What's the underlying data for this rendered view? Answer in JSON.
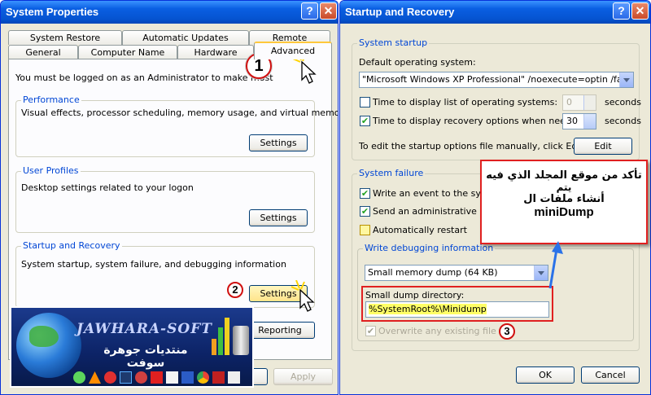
{
  "sys": {
    "title": "System Properties",
    "tabs_back": [
      "System Restore",
      "Automatic Updates",
      "Remote"
    ],
    "tabs_front": [
      "General",
      "Computer Name",
      "Hardware",
      "Advanced"
    ],
    "admin_note": "You must be logged on as an Administrator to make most of these changes.",
    "performance": {
      "title": "Performance",
      "desc": "Visual effects, processor scheduling, memory usage, and virtual memory",
      "button": "Settings"
    },
    "profiles": {
      "title": "User Profiles",
      "desc": "Desktop settings related to your logon",
      "button": "Settings"
    },
    "startup": {
      "title": "Startup and Recovery",
      "desc": "System startup, system failure, and debugging information",
      "button": "Settings"
    },
    "reporting_button": "Reporting",
    "apply_button": "Apply"
  },
  "dlg": {
    "title": "Startup and Recovery",
    "system_startup": {
      "title": "System startup",
      "default_os_label": "Default operating system:",
      "default_os_value": "\"Microsoft Windows XP Professional\" /noexecute=optin /fastdetect",
      "time_list_label": "Time to display list of operating systems:",
      "time_list_value": "0",
      "time_recovery_label": "Time to display recovery options when needed:",
      "time_recovery_value": "30",
      "seconds": "seconds",
      "edit_note": "To edit the startup options file manually, click Edit.",
      "edit_button": "Edit"
    },
    "system_failure": {
      "title": "System failure",
      "write_event": "Write an event to the system log",
      "send_alert": "Send an administrative alert",
      "auto_restart": "Automatically restart",
      "debug_title": "Write debugging information",
      "debug_type": "Small memory dump (64 KB)",
      "dump_dir_label": "Small dump directory:",
      "dump_dir_value": "%SystemRoot%\\Minidump",
      "overwrite": "Overwrite any existing file"
    },
    "ok_button": "OK",
    "cancel_button": "Cancel"
  },
  "annotations": {
    "markers": [
      "1",
      "2",
      "3"
    ],
    "callout_line1": "تأكد من موقع المجلد الذي فيه",
    "callout_line2": "يتم",
    "callout_line3": "أنشاء ملفات ال",
    "callout_line4": "miniDump"
  },
  "banner": {
    "brand": "JAWHARA-SOFT",
    "subtitle": "منتديات جوهرة سوفت"
  },
  "checks": {
    "write_event": true,
    "send_alert": true,
    "auto_restart": false,
    "overwrite": true,
    "time_list": false,
    "time_recovery": true
  },
  "colors": {
    "title_blue": "#0a5fe2",
    "annotation_red": "#d01010",
    "highlight_yellow": "#ffff66",
    "callout_border": "#e02020"
  }
}
